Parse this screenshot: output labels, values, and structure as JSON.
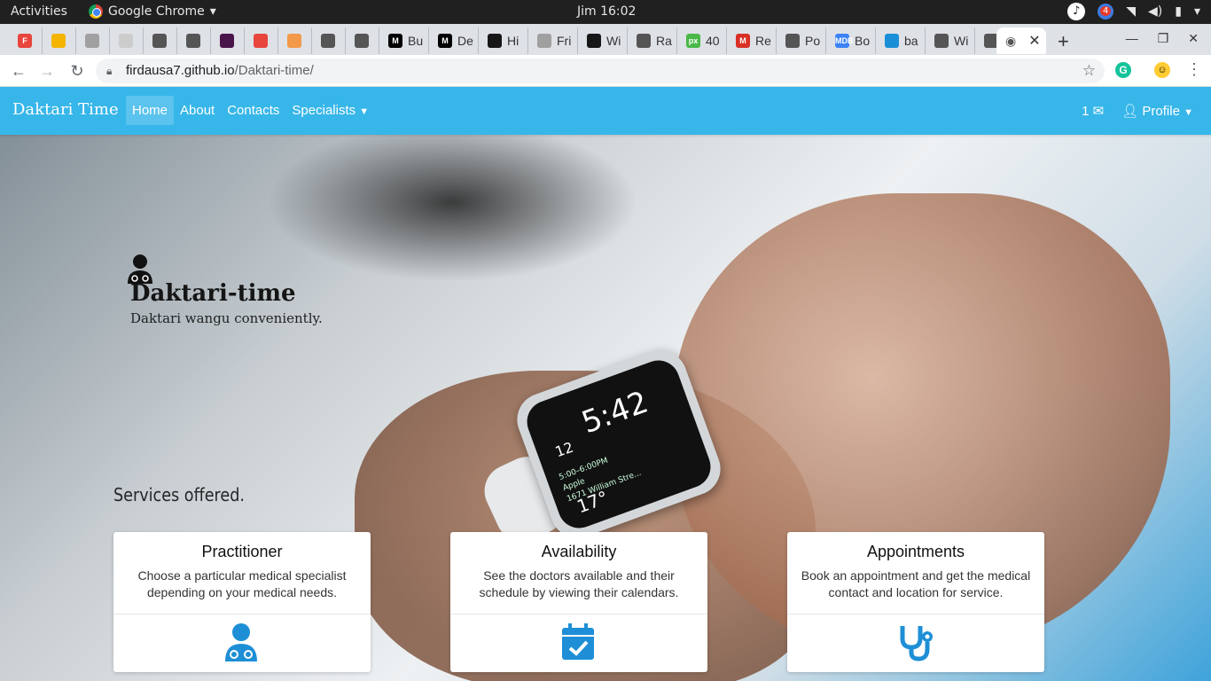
{
  "os": {
    "activities": "Activities",
    "app_name": "Google Chrome",
    "clock": "Jim 16:02",
    "badge_count": "4"
  },
  "tabs": [
    {
      "label": "",
      "color": "#e8453c",
      "icon": "F"
    },
    {
      "label": "",
      "color": "#f4b400",
      "icon": ""
    },
    {
      "label": "",
      "color": "#a0a0a0",
      "icon": ""
    },
    {
      "label": "",
      "color": "#cccccc",
      "icon": ""
    },
    {
      "label": "",
      "color": "#555",
      "icon": ""
    },
    {
      "label": "",
      "color": "#555",
      "icon": ""
    },
    {
      "label": "",
      "color": "#4a154b",
      "icon": ""
    },
    {
      "label": "",
      "color": "#e8453c",
      "icon": ""
    },
    {
      "label": "",
      "color": "#f2994a",
      "icon": ""
    },
    {
      "label": "",
      "color": "#555",
      "icon": ""
    },
    {
      "label": "",
      "color": "#555",
      "icon": ""
    },
    {
      "label": "Bu",
      "color": "#000",
      "icon": "M"
    },
    {
      "label": "De",
      "color": "#000",
      "icon": "M"
    },
    {
      "label": "Hi",
      "color": "#181717",
      "icon": ""
    },
    {
      "label": "Fri",
      "color": "#a0a0a0",
      "icon": ""
    },
    {
      "label": "Wi",
      "color": "#181717",
      "icon": ""
    },
    {
      "label": "Ra",
      "color": "#555",
      "icon": ""
    },
    {
      "label": "40",
      "color": "#4ab848",
      "icon": "px"
    },
    {
      "label": "Re",
      "color": "#d93025",
      "icon": "M"
    },
    {
      "label": "Po",
      "color": "#555",
      "icon": ""
    },
    {
      "label": "Bo",
      "color": "#3b82f6",
      "icon": "MDB"
    },
    {
      "label": "ba",
      "color": "#1a8fd8",
      "icon": ""
    },
    {
      "label": "Wi",
      "color": "#555",
      "icon": ""
    },
    {
      "label": "",
      "color": "#555",
      "icon": ""
    }
  ],
  "omnibox": {
    "host": "firdausa7.github.io",
    "path": "/Daktari-time/"
  },
  "nav": {
    "brand": "Daktari Time",
    "links": [
      "Home",
      "About",
      "Contacts",
      "Specialists"
    ],
    "messages_count": "1",
    "profile": "Profile"
  },
  "hero": {
    "title": "Daktari-time",
    "subtitle": "Daktari wangu conveniently.",
    "watch_time": "5:42",
    "watch_date": "12",
    "watch_event1": "5:00–6:00PM",
    "watch_event2": "Apple",
    "watch_event3": "1671 William Stre...",
    "watch_temp": "17°"
  },
  "services": {
    "heading": "Services offered.",
    "cards": [
      {
        "title": "Practitioner",
        "text": "Choose a particular medical specialist depending on your medical needs.",
        "icon": "doctor-icon"
      },
      {
        "title": "Availability",
        "text": "See the doctors available and their schedule by viewing their calendars.",
        "icon": "calendar-check-icon"
      },
      {
        "title": "Appointments",
        "text": "Book an appointment and get the medical contact and location for service.",
        "icon": "stethoscope-icon"
      }
    ]
  },
  "colors": {
    "nav": "#37b6e9",
    "icon": "#1e8fd6"
  }
}
